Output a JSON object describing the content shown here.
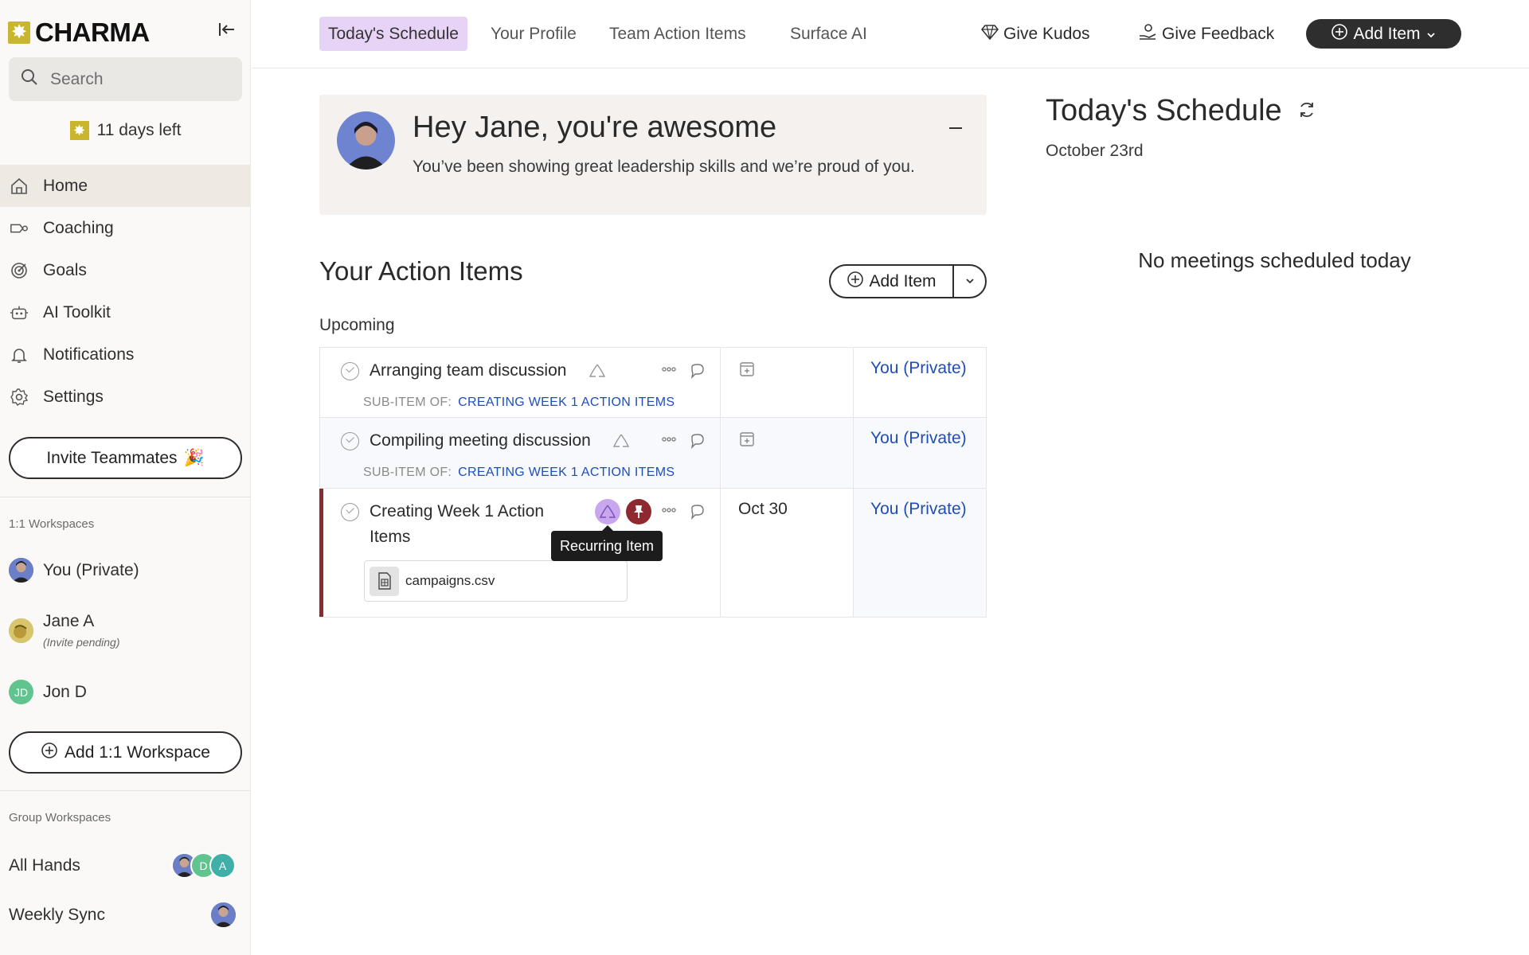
{
  "app": {
    "logo_text": "CHARMA",
    "brand_color": "#c9b52e"
  },
  "sidebar": {
    "search_placeholder": "Search",
    "trial_text": "11 days left",
    "nav": [
      {
        "label": "Home",
        "icon": "home-icon"
      },
      {
        "label": "Coaching",
        "icon": "coaching-icon"
      },
      {
        "label": "Goals",
        "icon": "target-icon"
      },
      {
        "label": "AI Toolkit",
        "icon": "robot-icon"
      },
      {
        "label": "Notifications",
        "icon": "bell-icon"
      },
      {
        "label": "Settings",
        "icon": "gear-icon"
      }
    ],
    "invite_label": "Invite Teammates",
    "one_on_one_label": "1:1 Workspaces",
    "workspaces": [
      {
        "name": "You (Private)"
      },
      {
        "name": "Jane A",
        "status": "(Invite pending)"
      },
      {
        "name": "Jon D",
        "initials": "JD"
      }
    ],
    "add_workspace_label": "Add 1:1 Workspace",
    "group_label": "Group Workspaces",
    "groups": [
      {
        "name": "All Hands",
        "avatars": [
          "",
          "D",
          "A"
        ]
      },
      {
        "name": "Weekly Sync"
      }
    ]
  },
  "topbar": {
    "tabs": [
      "Today's Schedule",
      "Your Profile",
      "Team Action Items",
      "Surface AI"
    ],
    "give_kudos": "Give Kudos",
    "give_feedback": "Give Feedback",
    "add_item": "Add Item"
  },
  "kudos": {
    "title": "Hey Jane, you're awesome",
    "text": "You’ve been showing great leadership skills and we’re proud of you."
  },
  "action_items": {
    "title": "Your Action Items",
    "add_item": "Add Item",
    "section": "Upcoming",
    "sub_item_prefix": "SUB-ITEM OF:",
    "rows": [
      {
        "title": "Arranging team discussion",
        "parent": "CREATING WEEK 1 ACTION ITEMS",
        "date": "",
        "owner": "You (Private)"
      },
      {
        "title": "Compiling meeting discussion",
        "parent": "CREATING WEEK 1 ACTION ITEMS",
        "date": "",
        "owner": "You (Private)"
      },
      {
        "title": "Creating Week 1 Action Items",
        "date": "Oct 30",
        "owner": "You (Private)",
        "attachment": "campaigns.csv",
        "flag_color": "#8e2a2f"
      }
    ],
    "tooltip": "Recurring Item"
  },
  "schedule": {
    "title": "Today's Schedule",
    "date": "October 23rd",
    "empty": "No meetings scheduled today"
  }
}
